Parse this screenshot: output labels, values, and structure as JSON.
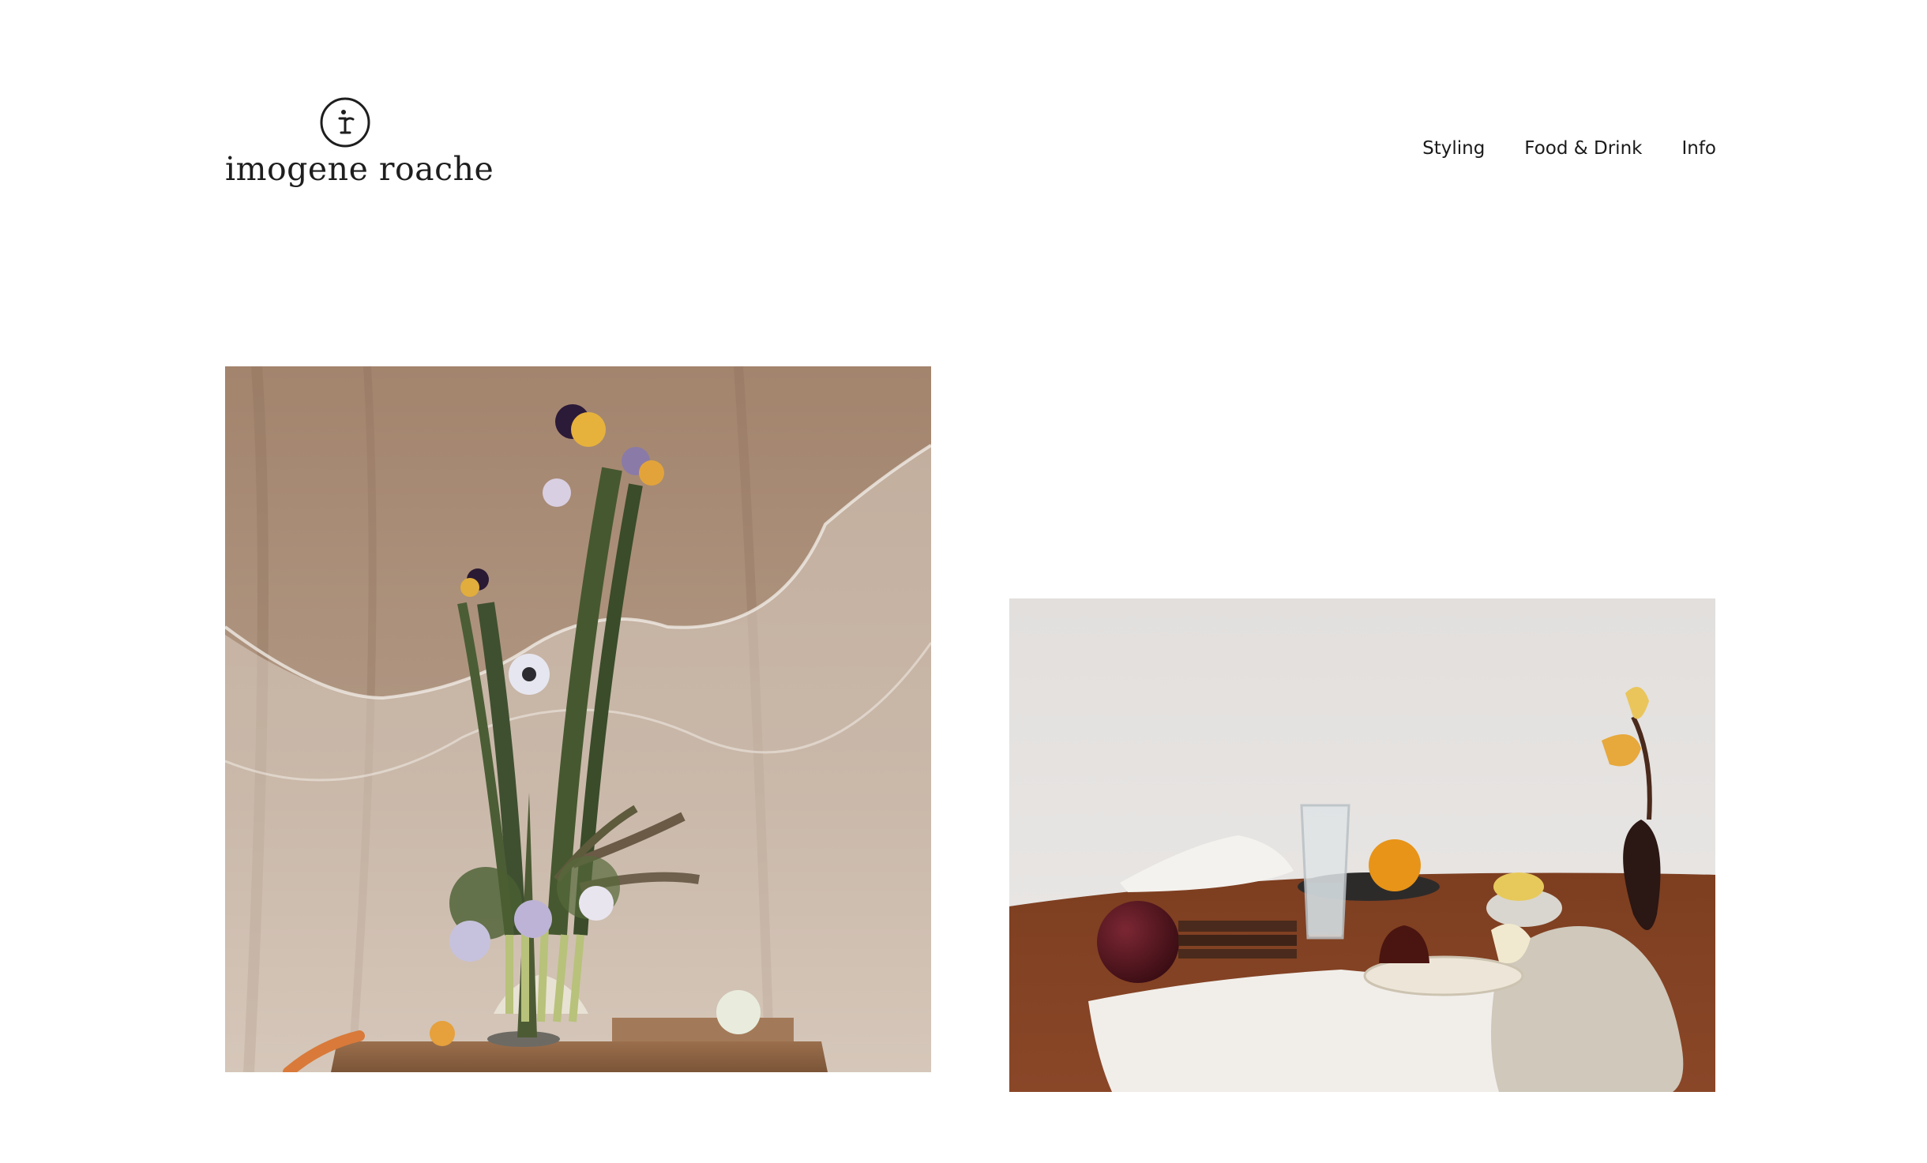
{
  "site": {
    "logo": {
      "monogram": "i",
      "wordmark": "imogene roache"
    },
    "nav": {
      "items": [
        {
          "label": "Styling"
        },
        {
          "label": "Food & Drink"
        },
        {
          "label": "Info"
        }
      ]
    }
  },
  "gallery": {
    "images": [
      {
        "icon": "floral-still-life-image"
      },
      {
        "icon": "table-setting-still-life-image"
      }
    ]
  }
}
